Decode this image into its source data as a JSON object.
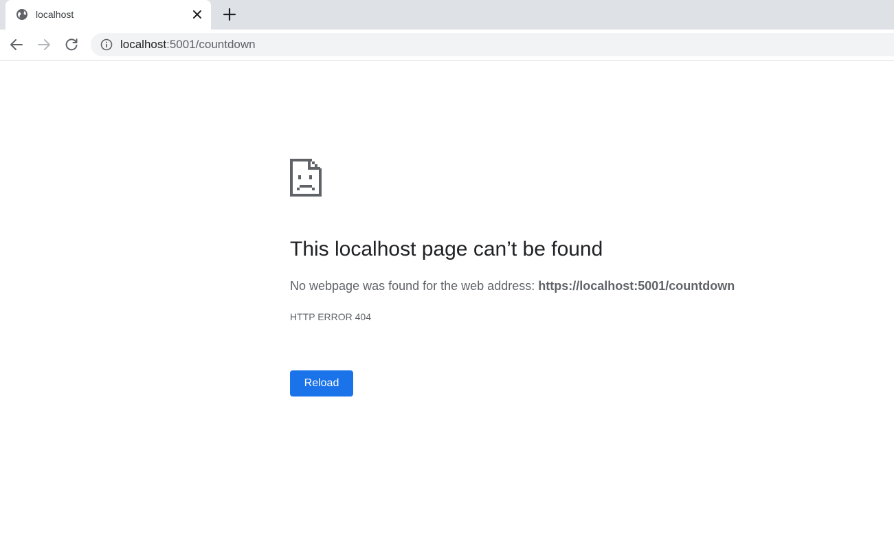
{
  "tab": {
    "title": "localhost",
    "favicon": "globe-icon"
  },
  "toolbar": {
    "url_host": "localhost",
    "url_rest": ":5001/countdown",
    "info_icon": "info-circle-icon"
  },
  "error": {
    "icon": "sad-page-icon",
    "title": "This localhost page can’t be found",
    "description_prefix": "No webpage was found for the web address: ",
    "description_url": "https://localhost:5001/countdown",
    "code": "HTTP ERROR 404",
    "reload_label": "Reload"
  },
  "colors": {
    "accent": "#1a73e8",
    "tabstrip_bg": "#dee1e6",
    "omnibox_bg": "#f1f3f4",
    "text_primary": "#202124",
    "text_secondary": "#5f6368"
  }
}
